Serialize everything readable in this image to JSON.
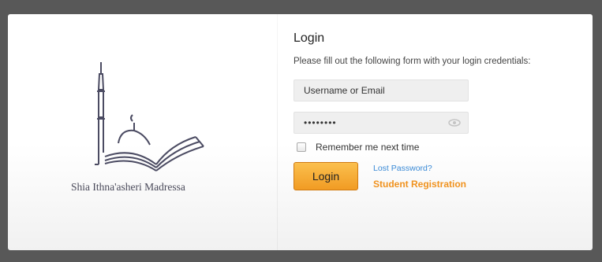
{
  "brand": {
    "name": "Shia Ithna'asheri Madressa"
  },
  "login": {
    "title": "Login",
    "subtitle": "Please fill out the following form with your login credentials:",
    "username_placeholder": "Username or Email",
    "password_value": "••••••••",
    "remember_label": "Remember me next time",
    "remember_checked": false,
    "submit_label": "Login",
    "lost_password_label": "Lost Password?",
    "registration_label": "Student Registration"
  },
  "colors": {
    "accent_orange": "#f19b23",
    "link_blue": "#3a8ad6",
    "registration_orange": "#f0921e",
    "frame_gray": "#585858"
  },
  "icons": {
    "password_toggle": "eye-icon",
    "logo": "mosque-book-logo"
  }
}
